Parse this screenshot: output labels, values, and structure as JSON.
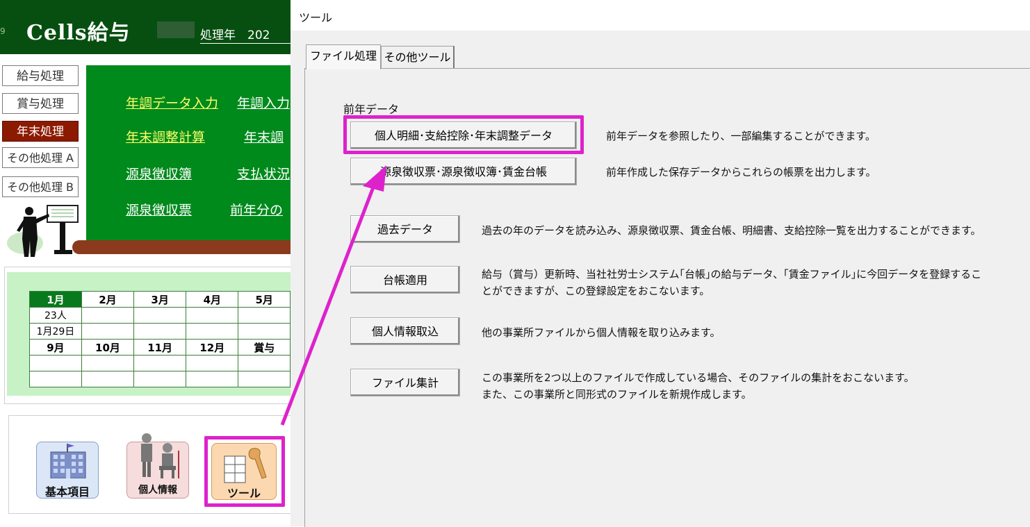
{
  "app": {
    "title": "Cells給与",
    "edge_number": "9",
    "year_label": "処理年　202"
  },
  "left_menu": [
    {
      "label": "給与処理",
      "active": false
    },
    {
      "label": "賞与処理",
      "active": false
    },
    {
      "label": "年末処理",
      "active": true
    },
    {
      "label": "その他処理 A",
      "active": false
    },
    {
      "label": "その他処理 B",
      "active": false
    }
  ],
  "board": {
    "links": [
      "年調データ入力",
      "年調入力",
      "年末調整計算",
      "年末調",
      "源泉徴収簿",
      "支払状況",
      "源泉徴収票",
      "前年分の"
    ]
  },
  "calendar": {
    "row1": [
      "1月",
      "2月",
      "3月",
      "4月",
      "5月"
    ],
    "row2": [
      "23人",
      "",
      "",
      "",
      ""
    ],
    "row3": [
      "1月29日",
      "",
      "",
      "",
      ""
    ],
    "row4": [
      "9月",
      "10月",
      "11月",
      "12月",
      "賞与"
    ],
    "row5": [
      "",
      "",
      "",
      "",
      ""
    ],
    "row6": [
      "",
      "",
      "",
      "",
      ""
    ]
  },
  "icons": {
    "kihon": "基本項目",
    "kojin": "個人情報",
    "tool": "ツール"
  },
  "dialog": {
    "title": "ツール",
    "tabs": [
      "ファイル処理",
      "その他ツール"
    ],
    "section_label": "前年データ",
    "buttons": {
      "prev_year_data": "個人明細･支給控除･年末調整データ",
      "withholding": "源泉徴収票･源泉徴収簿･賃金台帳",
      "past_data": "過去データ",
      "ledger": "台帳適用",
      "personal_import": "個人情報取込",
      "file_total": "ファイル集計"
    },
    "descriptions": {
      "prev_year_data": "前年データを参照したり、一部編集することができます。",
      "withholding": "前年作成した保存データからこれらの帳票を出力します。",
      "past_data": "過去の年のデータを読み込み、源泉徴収票、賃金台帳、明細書、支給控除一覧を出力することができます。",
      "ledger_line1": "給与（賞与）更新時、当社社労士システム｢台帳｣の給与データ、｢賃金ファイル｣に今回データを登録するこ",
      "ledger_line2": "とができますが、この登録設定をおこないます。",
      "personal_import": "他の事業所ファイルから個人情報を取り込みます。",
      "file_total_line1": "この事業所を2つ以上のファイルで作成している場合、そのファイルの集計をおこないます。",
      "file_total_line2": "また、この事業所と同形式のファイルを新規作成します。"
    }
  },
  "colors": {
    "highlight": "#dd22cc",
    "title_green": "#064f10",
    "board_green": "#008a1c",
    "active_menu": "#8c1a00",
    "calendar_bg": "#c6f2c6"
  }
}
